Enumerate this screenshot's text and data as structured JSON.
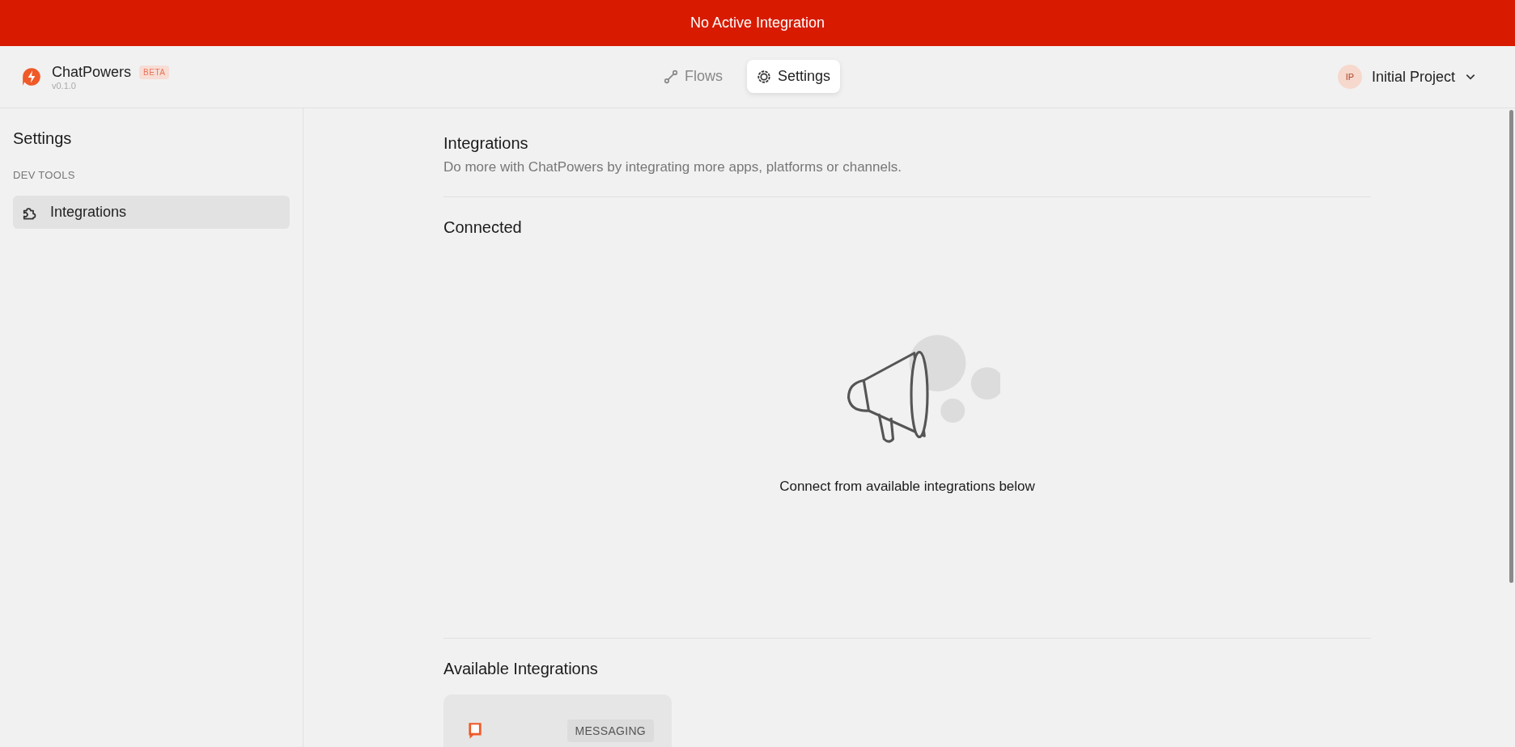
{
  "banner": {
    "text": "No Active Integration"
  },
  "app": {
    "name": "ChatPowers",
    "badge": "BETA",
    "version": "v0.1.0"
  },
  "tabs": [
    {
      "label": "Flows",
      "kind": "flow",
      "selected": false
    },
    {
      "label": "Settings",
      "kind": "gear",
      "selected": true
    }
  ],
  "project": {
    "initials": "IP",
    "name": "Initial Project"
  },
  "sidebar": {
    "title": "Settings",
    "section": "DEV TOOLS",
    "items": [
      {
        "label": "Integrations",
        "selected": true
      }
    ]
  },
  "main": {
    "title": "Integrations",
    "subtitle": "Do more with ChatPowers by integrating more apps, platforms or channels.",
    "connected": {
      "heading": "Connected",
      "empty_text": "Connect from available integrations below"
    },
    "available": {
      "heading": "Available Integrations",
      "cards": [
        {
          "tag": "MESSAGING"
        }
      ]
    }
  }
}
